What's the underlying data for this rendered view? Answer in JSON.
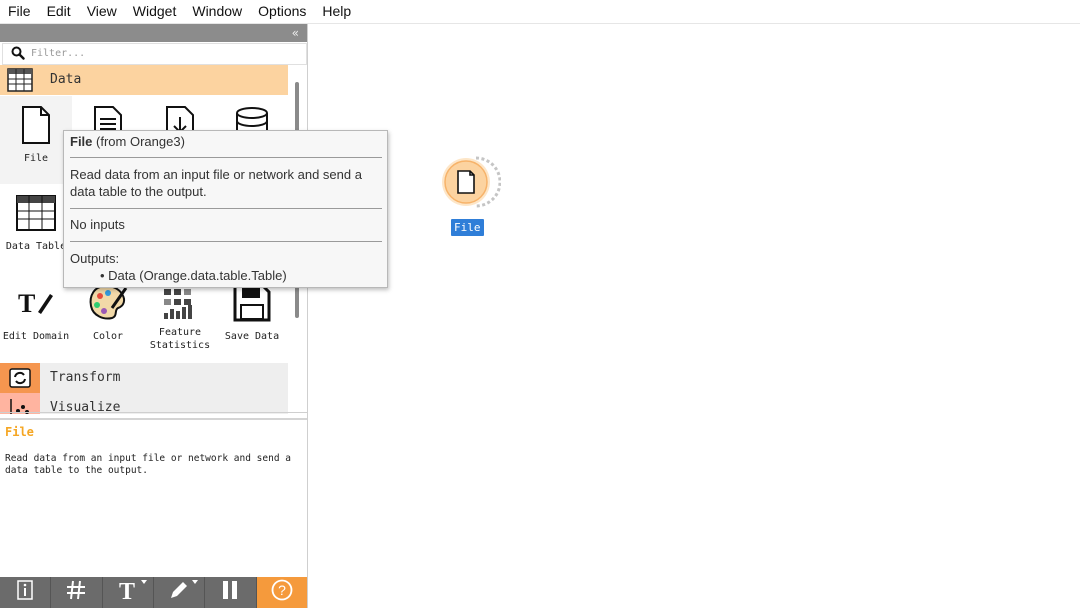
{
  "menu": [
    "File",
    "Edit",
    "View",
    "Widget",
    "Window",
    "Options",
    "Help"
  ],
  "dock": {
    "collapse_label": "«",
    "filter_placeholder": "Filter...",
    "categories": {
      "data": "Data",
      "transform": "Transform",
      "visualize": "Visualize"
    },
    "widgets": [
      {
        "label": "File",
        "icon": "file-icon"
      },
      {
        "label": "",
        "icon": "csv-file-icon"
      },
      {
        "label": "",
        "icon": "datasets-icon"
      },
      {
        "label": "",
        "icon": "sql-table-icon"
      },
      {
        "label": "Data Table",
        "icon": "data-table-icon"
      },
      {
        "label": "Edit Domain",
        "icon": "edit-domain-icon"
      },
      {
        "label": "Color",
        "icon": "color-palette-icon"
      },
      {
        "label": "Feature\nStatistics",
        "icon": "feature-statistics-icon"
      },
      {
        "label": "Save Data",
        "icon": "save-data-icon"
      }
    ],
    "description": {
      "title": "File",
      "text": "Read data from an input file or network and send a data table to the output."
    },
    "toolbar": [
      "info-icon",
      "grid-icon",
      "text-icon",
      "pen-icon",
      "pause-icon",
      "help-icon"
    ],
    "accent": "#f59a3c"
  },
  "tooltip": {
    "name": "File",
    "source": "(from Orange3)",
    "description": "Read data from an input file or network and send a data table to the output.",
    "inputs": "No inputs",
    "outputs_label": "Outputs:",
    "outputs": [
      "Data (Orange.data.table.Table)"
    ]
  },
  "canvas": {
    "node_label": "File",
    "node_color": "#fcd3a0",
    "label_bg": "#2f7ed8"
  }
}
